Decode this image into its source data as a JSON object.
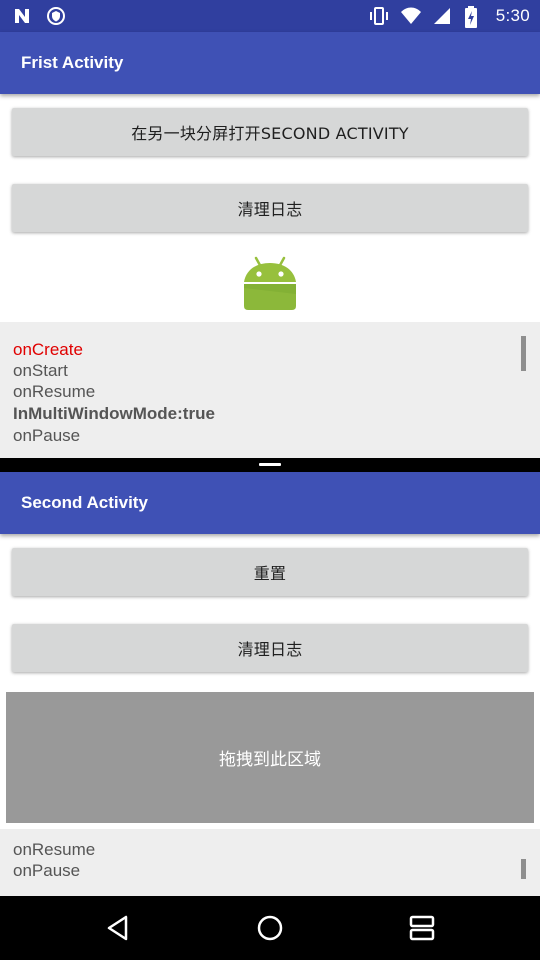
{
  "status_bar": {
    "time": "5:30",
    "left_icons": [
      "n-notification-icon",
      "shield-notification-icon"
    ],
    "right_icons": [
      "vibrate-icon",
      "wifi-icon",
      "signal-icon",
      "battery-icon"
    ],
    "color": "#303f9f"
  },
  "top_window": {
    "title": "Frist Activity",
    "appbar_color": "#3f51b5",
    "open_button_label": "在另一块分屏打开SECOND ACTIVITY",
    "clear_log_label": "清理日志",
    "icon": "android-robot-icon",
    "log": [
      {
        "text": "onCreate",
        "style": "red"
      },
      {
        "text": "onStart",
        "style": "normal"
      },
      {
        "text": "onResume",
        "style": "normal"
      },
      {
        "text": "InMultiWindowMode:true",
        "style": "bold"
      },
      {
        "text": "onPause",
        "style": "normal"
      }
    ]
  },
  "bottom_window": {
    "title": "Second Activity",
    "appbar_color": "#3f51b5",
    "reset_button_label": "重置",
    "clear_log_label": "清理日志",
    "drop_area_label": "拖拽到此区域",
    "log": [
      {
        "text": "onResume",
        "style": "normal"
      },
      {
        "text": "onPause",
        "style": "normal"
      }
    ]
  },
  "nav_bar": {
    "buttons": [
      "back-icon",
      "home-icon",
      "recents-icon"
    ]
  }
}
